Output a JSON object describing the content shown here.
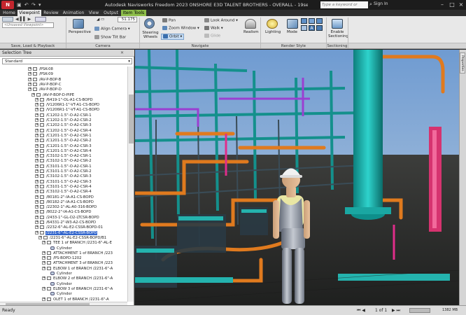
{
  "app": {
    "logo": "N",
    "title": "Autodesk Navisworks Freedom 2023   ONSHORE E3D TALENT BROTHERS - OVERALL - 19sep2018.nwd",
    "search_placeholder": "Type a keyword or phrase",
    "sign_in": "Sign In"
  },
  "tabs": [
    "Home",
    "Viewpoint",
    "Review",
    "Animation",
    "View",
    "Output",
    "Item Tools"
  ],
  "active_tab": "Viewpoint",
  "ribbon": {
    "saved_viewpoint_value": "<Unsaved Viewpoint>",
    "field_value": "51.175",
    "perspective": "Perspective",
    "align_camera": "Align Camera",
    "show_tilt_bar": "Show Tilt Bar",
    "steering_wheels": "Steering Wheels",
    "pan": "Pan",
    "zoom_window": "Zoom Window",
    "orbit": "Orbit",
    "look_around": "Look Around",
    "walk": "Walk",
    "glide": "Glide",
    "realism": "Realism",
    "lighting": "Lighting",
    "mode": "Mode",
    "enable_sectioning": "Enable Sectioning",
    "groups": [
      "Save, Load & Playback",
      "Camera",
      "Navigate",
      "Render Style",
      "Sectioning"
    ]
  },
  "selection_tree": {
    "title": "Selection Tree",
    "mode": "Standard",
    "rows": [
      {
        "depth": 0,
        "icon": "box",
        "label": "/PSK-08"
      },
      {
        "depth": 0,
        "icon": "box",
        "label": "/PSK-09"
      },
      {
        "depth": 0,
        "icon": "box",
        "label": "/AV-P-BOP-B"
      },
      {
        "depth": 0,
        "icon": "box",
        "label": "/AV-P-BOP-C"
      },
      {
        "depth": 0,
        "icon": "box",
        "label": "/AV-P-BOP-D"
      },
      {
        "depth": 1,
        "icon": "box",
        "label": "/AV-P-BOP-D-PIPE"
      },
      {
        "depth": 2,
        "icon": "box",
        "label": "/6419-1\"-OL-A1-CS-BOPD"
      },
      {
        "depth": 2,
        "icon": "box",
        "label": "/V1206R1-1\"-VT-A1-CS-BOPD"
      },
      {
        "depth": 2,
        "icon": "box",
        "label": "/V1206R1-1\"-VT-A1-CS-BOPD"
      },
      {
        "depth": 2,
        "icon": "box",
        "label": "/C1202-1.5\"-O-A2-CSR-1"
      },
      {
        "depth": 2,
        "icon": "box",
        "label": "/C1202-1.5\"-O-A2-CSR-2"
      },
      {
        "depth": 2,
        "icon": "box",
        "label": "/C1202-1.5\"-O-A2-CSR-3"
      },
      {
        "depth": 2,
        "icon": "box",
        "label": "/C1202-1.5\"-O-A2-CSR-4"
      },
      {
        "depth": 2,
        "icon": "box",
        "label": "/C1201-1.5\"-O-A2-CSR-1"
      },
      {
        "depth": 2,
        "icon": "box",
        "label": "/C1201-1.5\"-O-A2-CSR-2"
      },
      {
        "depth": 2,
        "icon": "box",
        "label": "/C1201-1.5\"-O-A2-CSR-3"
      },
      {
        "depth": 2,
        "icon": "box",
        "label": "/C1201-1.5\"-O-A2-CSR-4"
      },
      {
        "depth": 2,
        "icon": "box",
        "label": "/C3102-1.5\"-O-A2-CSR-1"
      },
      {
        "depth": 2,
        "icon": "box",
        "label": "/C3102-1.5\"-O-A2-CSR-2"
      },
      {
        "depth": 2,
        "icon": "box",
        "label": "/C3101-1.5\"-O-A2-CSR-1"
      },
      {
        "depth": 2,
        "icon": "box",
        "label": "/C3101-1.5\"-O-A2-CSR-2"
      },
      {
        "depth": 2,
        "icon": "box",
        "label": "/C3102-1.5\"-O-A2-CSR-3"
      },
      {
        "depth": 2,
        "icon": "box",
        "label": "/C3101-1.5\"-O-A2-CSR-3"
      },
      {
        "depth": 2,
        "icon": "box",
        "label": "/C3101-1.5\"-O-A2-CSR-4"
      },
      {
        "depth": 2,
        "icon": "box",
        "label": "/C3102-1.5\"-O-A2-CSR-4"
      },
      {
        "depth": 2,
        "icon": "box",
        "label": "/80181-2\"-IA-A1-CS-BOPD"
      },
      {
        "depth": 2,
        "icon": "box",
        "label": "/80182-2\"-IA-A1-CS-BOPD"
      },
      {
        "depth": 2,
        "icon": "box",
        "label": "/22302-1\"-AL-A0-316-BOPD"
      },
      {
        "depth": 2,
        "icon": "box",
        "label": "/8022-2\"-IA-A1-CS-BOPD"
      },
      {
        "depth": 2,
        "icon": "box",
        "label": "/2433-1\"-GL-D2-LTCSR-BOPD"
      },
      {
        "depth": 2,
        "icon": "box",
        "label": "/64331-2\"-W3-A2-CS-BOPD"
      },
      {
        "depth": 2,
        "icon": "box",
        "label": "/2232-6\"-AL-E2-CSSR-BOPD-01"
      },
      {
        "depth": 2,
        "icon": "box",
        "label": "/2231-6\"-AL-E2-CSSR-BOPD",
        "selected": true
      },
      {
        "depth": 3,
        "icon": "box",
        "label": "/2231-6\"-AL-E2-CSSR-BOPD/B1"
      },
      {
        "depth": 4,
        "icon": "box",
        "label": "TEE 1 of BRANCH /2231-6\"-AL-E"
      },
      {
        "depth": 5,
        "icon": "cyl",
        "label": "Cylinder"
      },
      {
        "depth": 4,
        "icon": "box",
        "label": "ATTACHMENT 1 of BRANCH /223"
      },
      {
        "depth": 4,
        "icon": "box",
        "label": "/PS-BOPD-1202"
      },
      {
        "depth": 4,
        "icon": "box",
        "label": "ATTACHMENT 3 of BRANCH /223"
      },
      {
        "depth": 4,
        "icon": "box",
        "label": "ELBOW 1 of BRANCH /2231-6\"-A"
      },
      {
        "depth": 5,
        "icon": "cyl",
        "label": "Cylinder"
      },
      {
        "depth": 4,
        "icon": "box",
        "label": "ELBOW 2 of BRANCH /2231-6\"-A"
      },
      {
        "depth": 5,
        "icon": "cyl",
        "label": "Cylinder"
      },
      {
        "depth": 4,
        "icon": "box",
        "label": "ELBOW 3 of BRANCH /2231-6\"-A"
      },
      {
        "depth": 5,
        "icon": "cyl",
        "label": "Cylinder"
      },
      {
        "depth": 4,
        "icon": "box",
        "label": "OLET 1 of BRANCH /2231-6\"-A"
      }
    ]
  },
  "viewport": {
    "side_tab": "Properties"
  },
  "status": {
    "text": "Ready",
    "page": "1 of 1",
    "memory": "1382 MB"
  },
  "colors": {
    "accent": "#c4262e",
    "item_tools": "#8dbe4a",
    "selection": "#3366cc",
    "pipe_orange": "#e07a1e",
    "cyan_structure": "#1fb6b1"
  }
}
